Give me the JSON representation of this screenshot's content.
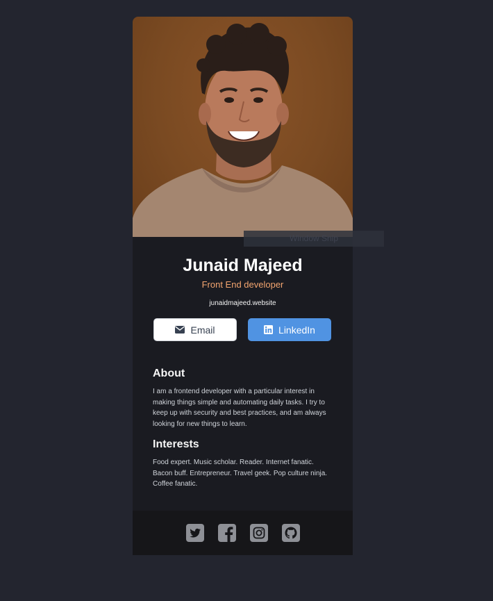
{
  "profile": {
    "name": "Junaid Majeed",
    "role": "Front End developer",
    "website": "junaidmajeed.website"
  },
  "buttons": {
    "email_label": "Email",
    "email_icon": "envelope-icon",
    "linkedin_label": "LinkedIn",
    "linkedin_icon": "linkedin-icon"
  },
  "about": {
    "heading": "About",
    "text": "I am a frontend developer with a particular interest in making things simple and automating daily tasks. I try to keep up with security and best practices, and am always looking for new things to learn."
  },
  "interests": {
    "heading": "Interests",
    "text": "Food expert. Music scholar. Reader. Internet fanatic. Bacon buff. Entrepreneur. Travel geek. Pop culture ninja. Coffee fanatic."
  },
  "footer": {
    "socials": [
      "twitter-icon",
      "facebook-icon",
      "instagram-icon",
      "github-icon"
    ]
  },
  "overlay": {
    "label": "Window Snip"
  },
  "colors": {
    "background": "#23252f",
    "card": "#1a1b21",
    "accent_orange": "#f3a56f",
    "linkedin_blue": "#5093e2",
    "footer": "#161619",
    "icon_gray": "#8e9096"
  }
}
